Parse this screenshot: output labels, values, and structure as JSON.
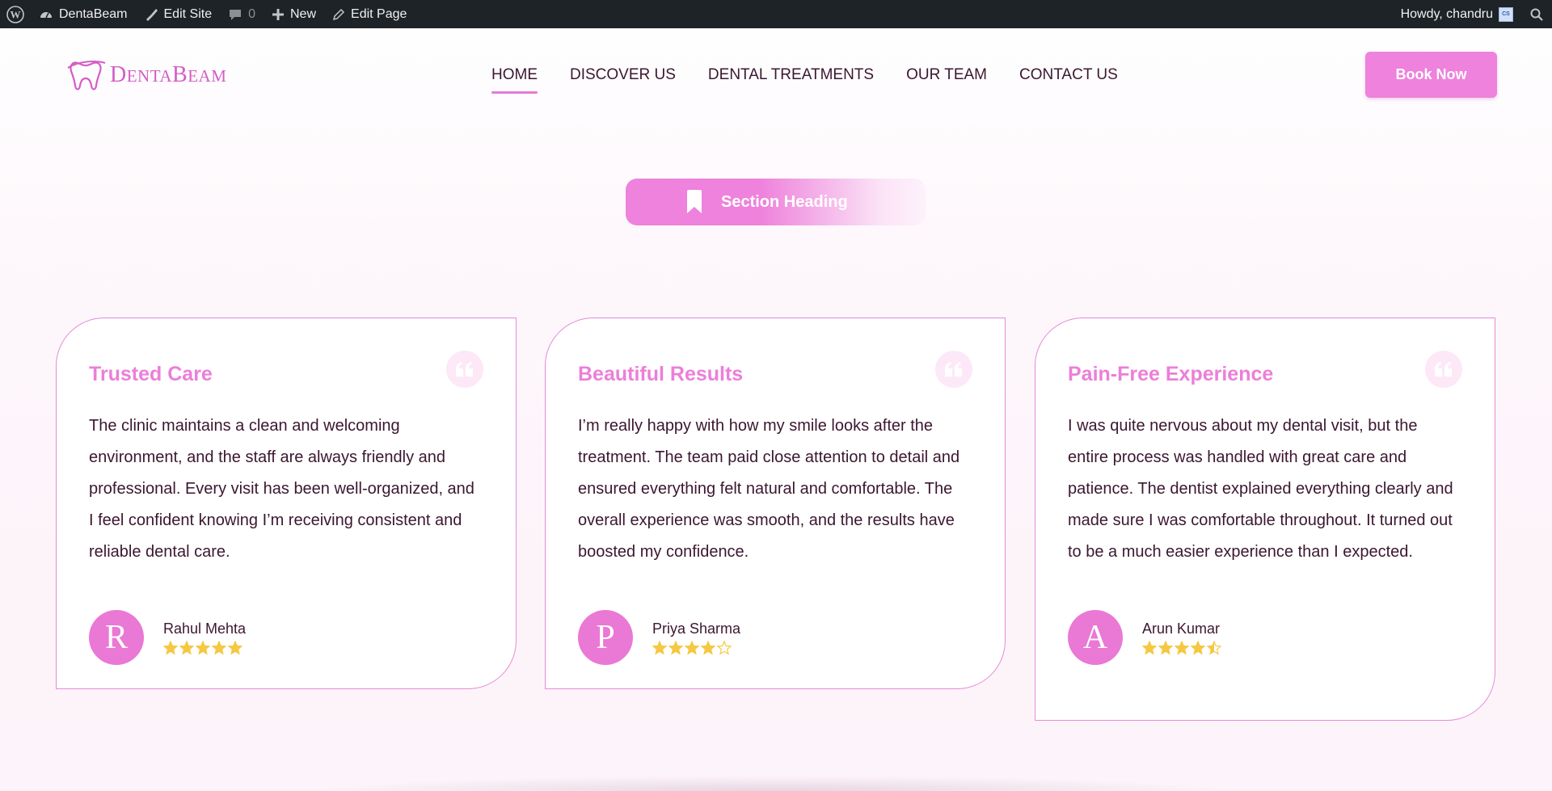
{
  "admin_bar": {
    "site_name": "DentaBeam",
    "edit_site": "Edit Site",
    "comments_count": "0",
    "new_label": "New",
    "edit_page": "Edit Page",
    "greeting": "Howdy, chandru",
    "avatar_initials": "CS"
  },
  "header": {
    "logo_first": "D",
    "logo_rest1": "ENTA",
    "logo_b": "B",
    "logo_rest2": "EAM",
    "nav": [
      {
        "label": "HOME",
        "active": true
      },
      {
        "label": "DISCOVER US"
      },
      {
        "label": "DENTAL TREATMENTS"
      },
      {
        "label": "OUR TEAM"
      },
      {
        "label": "CONTACT US"
      }
    ],
    "book_button": "Book Now"
  },
  "section": {
    "heading": "Section Heading"
  },
  "testimonials": [
    {
      "title": "Trusted Care",
      "body": "The clinic maintains a clean and welcoming environment, and the staff are always friendly and professional. Every visit has been well-organized, and I feel confident knowing I’m receiving consistent and reliable dental care.",
      "initial": "R",
      "name": "Rahul Mehta",
      "rating": 5
    },
    {
      "title": "Beautiful Results",
      "body": "I’m really happy with how my smile looks after the treatment. The team paid close attention to detail and ensured everything felt natural and comfortable. The overall experience was smooth, and the results have boosted my confidence.",
      "initial": "P",
      "name": "Priya Sharma",
      "rating": 4
    },
    {
      "title": "Pain-Free Experience",
      "body": "I was quite nervous about my dental visit, but the entire process was handled with great care and patience. The dentist explained everything clearly and made sure I was comfortable throughout. It turned out to be a much easier experience than I expected.",
      "initial": "A",
      "name": "Arun Kumar",
      "rating": 4.5
    }
  ],
  "colors": {
    "accent": "#ee82dc",
    "title_pink": "#ec7ed9",
    "star": "#f5c842",
    "admin_bar_bg": "#1d2327"
  }
}
